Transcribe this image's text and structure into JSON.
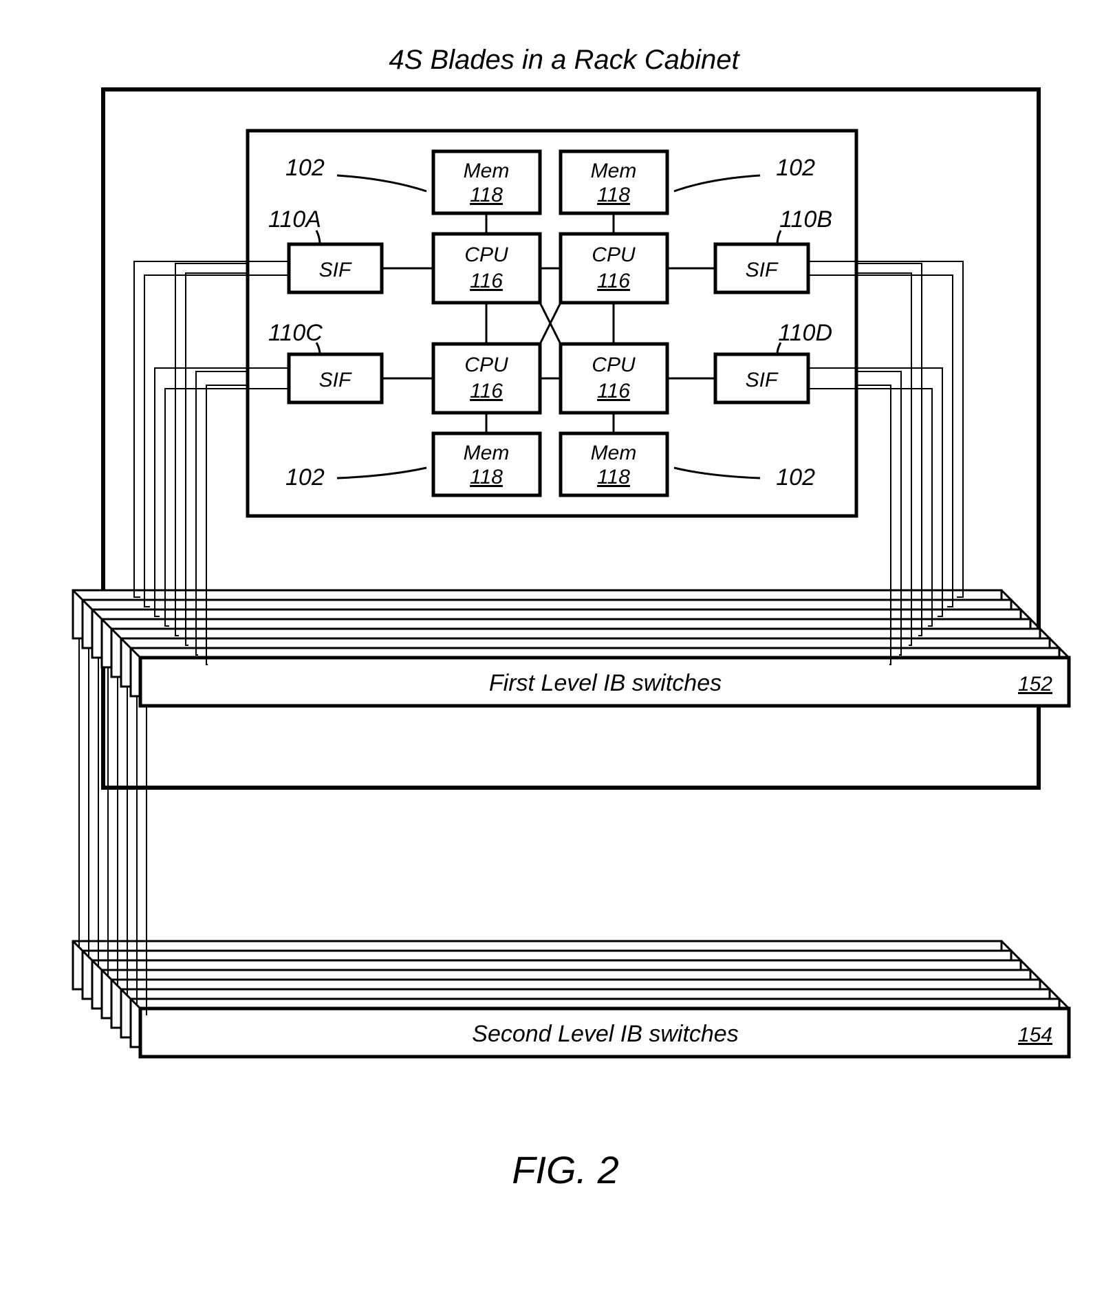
{
  "title": "4S Blades in a Rack Cabinet",
  "figure": "FIG. 2",
  "node_labels": {
    "ref102": "102",
    "ref110A": "110A",
    "ref110B": "110B",
    "ref110C": "110C",
    "ref110D": "110D"
  },
  "blocks": {
    "sif": "SIF",
    "cpu": "CPU",
    "cpu_ref": "116",
    "mem": "Mem",
    "mem_ref": "118"
  },
  "switches": {
    "first_label": "First Level IB switches",
    "first_ref": "152",
    "second_label": "Second Level IB switches",
    "second_ref": "154"
  }
}
